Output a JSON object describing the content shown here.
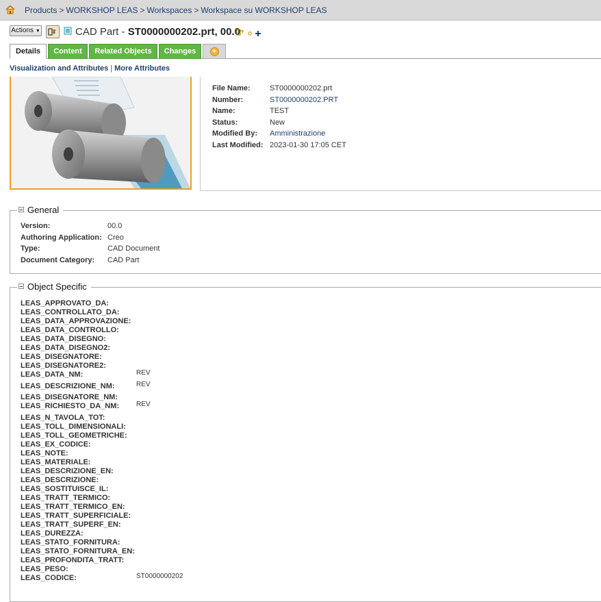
{
  "breadcrumb": {
    "items": [
      "Products",
      "WORKSHOP LEAS",
      "Workspaces",
      "Workspace su WORKSHOP LEAS"
    ],
    "separator": ">"
  },
  "header": {
    "actions_label": "Actions",
    "type_label": "CAD Part - ",
    "object_name": "ST0000000202.prt, 00.0"
  },
  "tabs": [
    {
      "label": "Details"
    },
    {
      "label": "Content"
    },
    {
      "label": "Related Objects"
    },
    {
      "label": "Changes"
    }
  ],
  "subnav": {
    "visualization": "Visualization and Attributes",
    "more": "More Attributes"
  },
  "summary": [
    {
      "label": "File Name:",
      "value": "ST0000000202.prt"
    },
    {
      "label": "Number:",
      "value": "ST0000000202.PRT"
    },
    {
      "label": "Name:",
      "value": "TEST"
    },
    {
      "label": "Status:",
      "value": "New"
    },
    {
      "label": "Modified By:",
      "value": "Amministrazione"
    },
    {
      "label": "Last Modified:",
      "value": "2023-01-30 17:05 CET"
    }
  ],
  "general": {
    "title": "General",
    "rows": [
      {
        "label": "Version:",
        "value": "00.0"
      },
      {
        "label": "Authoring Application:",
        "value": "Creo"
      },
      {
        "label": "Type:",
        "value": "CAD Document"
      },
      {
        "label": "Document Category:",
        "value": "CAD Part"
      }
    ]
  },
  "object_specific": {
    "title": "Object Specific",
    "rows": [
      {
        "label": "LEAS_APPROVATO_DA:",
        "value": ""
      },
      {
        "label": "LEAS_CONTROLLATO_DA:",
        "value": ""
      },
      {
        "label": "LEAS_DATA_APPROVAZIONE:",
        "value": ""
      },
      {
        "label": "LEAS_DATA_CONTROLLO:",
        "value": ""
      },
      {
        "label": "LEAS_DATA_DISEGNO:",
        "value": ""
      },
      {
        "label": "LEAS_DATA_DISEGNO2:",
        "value": ""
      },
      {
        "label": "LEAS_DISEGNATORE:",
        "value": ""
      },
      {
        "label": "LEAS_DISEGNATORE2:",
        "value": ""
      },
      {
        "label": "LEAS_DATA_NM:",
        "value": "REV"
      },
      {
        "label": "LEAS_DESCRIZIONE_NM:",
        "value": "REV"
      },
      {
        "label": "LEAS_DISEGNATORE_NM:",
        "value": ""
      },
      {
        "label": "LEAS_RICHIESTO_DA_NM:",
        "value": "REV"
      },
      {
        "label": "LEAS_N_TAVOLA_TOT:",
        "value": ""
      },
      {
        "label": "LEAS_TOLL_DIMENSIONALI:",
        "value": ""
      },
      {
        "label": "LEAS_TOLL_GEOMETRICHE:",
        "value": ""
      },
      {
        "label": "LEAS_EX_CODICE:",
        "value": ""
      },
      {
        "label": "LEAS_NOTE:",
        "value": ""
      },
      {
        "label": "LEAS_MATERIALE:",
        "value": ""
      },
      {
        "label": "LEAS_DESCRIZIONE_EN:",
        "value": ""
      },
      {
        "label": "LEAS_DESCRIZIONE:",
        "value": ""
      },
      {
        "label": "LEAS_SOSTITUISCE_IL:",
        "value": ""
      },
      {
        "label": "LEAS_TRATT_TERMICO:",
        "value": ""
      },
      {
        "label": "LEAS_TRATT_TERMICO_EN:",
        "value": ""
      },
      {
        "label": "LEAS_TRATT_SUPERFICIALE:",
        "value": ""
      },
      {
        "label": "LEAS_TRATT_SUPERF_EN:",
        "value": ""
      },
      {
        "label": "LEAS_DUREZZA:",
        "value": ""
      },
      {
        "label": "LEAS_STATO_FORNITURA:",
        "value": ""
      },
      {
        "label": "LEAS_STATO_FORNITURA_EN:",
        "value": ""
      },
      {
        "label": "LEAS_PROFONDITA_TRATT:",
        "value": ""
      },
      {
        "label": "LEAS_PESO:",
        "value": ""
      },
      {
        "label": "LEAS_CODICE:",
        "value": "ST0000000202"
      }
    ]
  },
  "colors": {
    "tab_green": "#5fb844",
    "link_blue": "#1f3f6e",
    "thumbnail_border": "#f0a020",
    "breadcrumb_bg": "#d9d9d9"
  }
}
